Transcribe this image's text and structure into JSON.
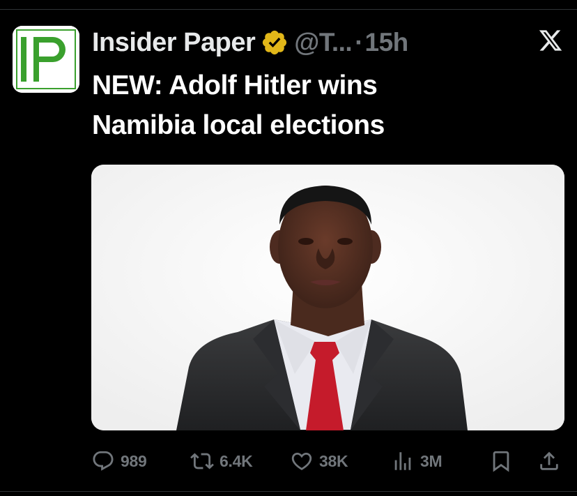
{
  "tweet": {
    "author_name": "Insider Paper",
    "handle": "@T...",
    "separator": "·",
    "time": "15h",
    "text_line1": "NEW: Adolf Hitler wins",
    "text_line2": "Namibia local elections",
    "avatar_text": "IP",
    "avatar_accent": "#3aa02d",
    "verified_color": "#e2b719",
    "media_alt": "Portrait of a man in a dark suit, white shirt and red tie against a white background"
  },
  "actions": {
    "replies": "989",
    "reposts": "6.4K",
    "likes": "38K",
    "views": "3M"
  },
  "icons": {
    "reply": "reply-icon",
    "repost": "repost-icon",
    "like": "heart-icon",
    "views": "views-icon",
    "bookmark": "bookmark-icon",
    "share": "share-icon",
    "x": "x-logo-icon"
  }
}
